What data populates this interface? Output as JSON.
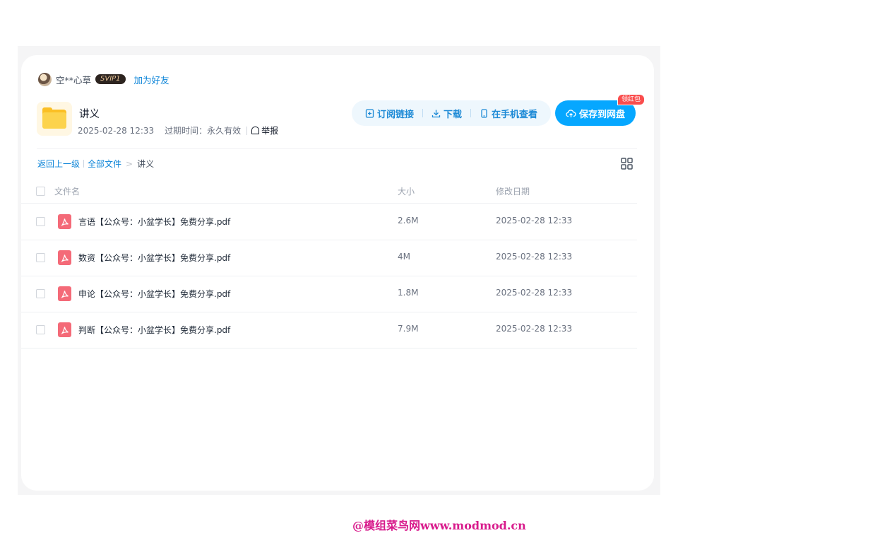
{
  "user": {
    "name": "空**心草",
    "vip": "SVIP1",
    "add_friend": "加为好友"
  },
  "share": {
    "title": "讲义",
    "date": "2025-02-28 12:33",
    "expiry": "过期时间：永久有效",
    "report": "举报"
  },
  "actions": {
    "subscribe": "订阅链接",
    "download": "下载",
    "phone": "在手机查看",
    "save": "保存到网盘",
    "red_packet": "领红包"
  },
  "breadcrumb": {
    "back": "返回上一级",
    "all": "全部文件",
    "current": "讲义"
  },
  "table": {
    "headers": {
      "name": "文件名",
      "size": "大小",
      "date": "修改日期"
    },
    "rows": [
      {
        "name": "言语【公众号：小盆学长】免费分享.pdf",
        "size": "2.6M",
        "date": "2025-02-28 12:33"
      },
      {
        "name": "数资【公众号：小盆学长】免费分享.pdf",
        "size": "4M",
        "date": "2025-02-28 12:33"
      },
      {
        "name": "申论【公众号：小盆学长】免费分享.pdf",
        "size": "1.8M",
        "date": "2025-02-28 12:33"
      },
      {
        "name": "判断【公众号：小盆学长】免费分享.pdf",
        "size": "7.9M",
        "date": "2025-02-28 12:33"
      }
    ]
  },
  "watermark": "@模组菜鸟网www.modmod.cn",
  "colors": {
    "accent": "#06a7ff",
    "link": "#0b84d8",
    "pdf": "#f46a78",
    "badge": "#fa4d4d"
  },
  "icons": [
    "avatar",
    "folder-icon",
    "report-icon",
    "subscribe-icon",
    "download-icon",
    "phone-icon",
    "cloud-upload-icon",
    "grid-view-icon",
    "pdf-icon"
  ]
}
